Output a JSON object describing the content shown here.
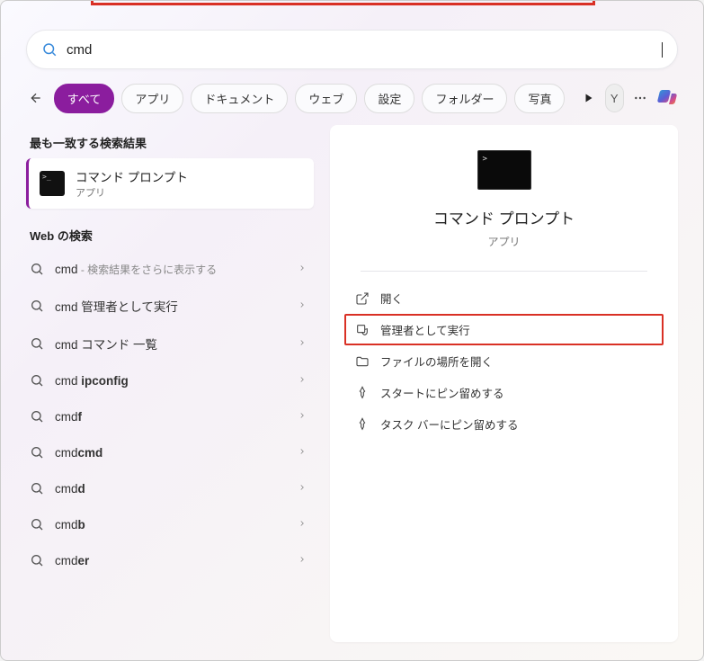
{
  "search": {
    "value": "cmd"
  },
  "tabs": {
    "all": "すべて",
    "apps": "アプリ",
    "documents": "ドキュメント",
    "web": "ウェブ",
    "settings": "設定",
    "folders": "フォルダー",
    "photos": "写真"
  },
  "avatar_letter": "Y",
  "left": {
    "best_match_header": "最も一致する検索結果",
    "best_match": {
      "title": "コマンド プロンプト",
      "subtitle": "アプリ"
    },
    "web_header": "Web の検索",
    "items": [
      {
        "prefix": "cmd",
        "bold": "",
        "suffix": " - 検索結果をさらに表示する",
        "sub": true
      },
      {
        "prefix": "cmd ",
        "bold": "",
        "suffix": "管理者として実行"
      },
      {
        "prefix": "cmd ",
        "bold": "",
        "suffix": "コマンド 一覧"
      },
      {
        "prefix": "cmd ",
        "bold": "ipconfig",
        "suffix": ""
      },
      {
        "prefix": "cmd",
        "bold": "f",
        "suffix": ""
      },
      {
        "prefix": "cmd",
        "bold": "cmd",
        "suffix": ""
      },
      {
        "prefix": "cmd",
        "bold": "d",
        "suffix": ""
      },
      {
        "prefix": "cmd",
        "bold": "b",
        "suffix": ""
      },
      {
        "prefix": "cmd",
        "bold": "er",
        "suffix": ""
      }
    ]
  },
  "right": {
    "title": "コマンド プロンプト",
    "subtitle": "アプリ",
    "actions": {
      "open": "開く",
      "run_admin": "管理者として実行",
      "open_location": "ファイルの場所を開く",
      "pin_start": "スタートにピン留めする",
      "pin_taskbar": "タスク バーにピン留めする"
    }
  }
}
